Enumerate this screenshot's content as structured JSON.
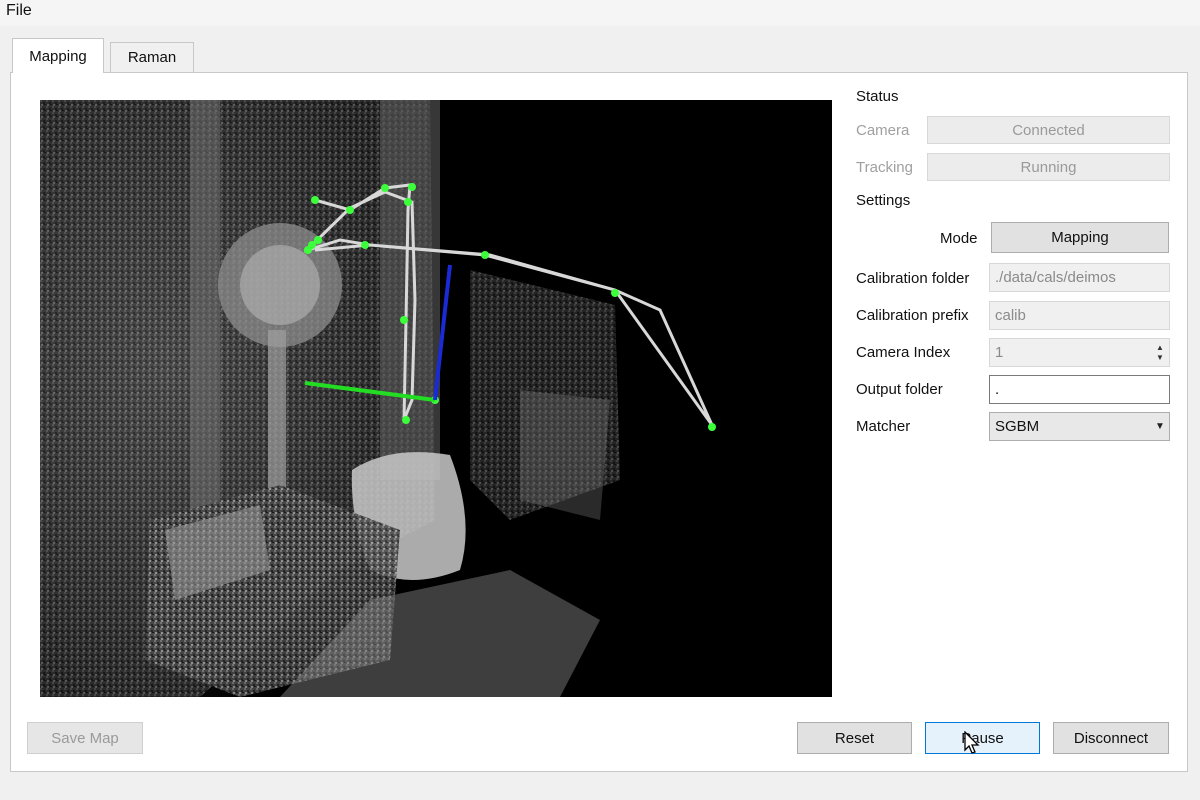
{
  "menu": {
    "file_label": "File"
  },
  "tabs": [
    {
      "label": "Mapping",
      "active": true
    },
    {
      "label": "Raman",
      "active": false
    }
  ],
  "status": {
    "title": "Status",
    "camera_label": "Camera",
    "camera_value": "Connected",
    "tracking_label": "Tracking",
    "tracking_value": "Running"
  },
  "settings": {
    "title": "Settings",
    "mode_label": "Mode",
    "mode_value": "Mapping",
    "calibration_folder_label": "Calibration folder",
    "calibration_folder_value": "./data/cals/deimos",
    "calibration_prefix_label": "Calibration prefix",
    "calibration_prefix_value": "calib",
    "camera_index_label": "Camera Index",
    "camera_index_value": "1",
    "output_folder_label": "Output folder",
    "output_folder_value": ".",
    "matcher_label": "Matcher",
    "matcher_value": "SGBM"
  },
  "buttons": {
    "save_map": "Save Map",
    "reset": "Reset",
    "pause": "Pause",
    "disconnect": "Disconnect"
  },
  "viewport": {
    "trajectory_color": "#d8d8d8",
    "keyframe_color": "#3cff3c",
    "axis_x_color": "#22dd22",
    "axis_z_color": "#1a2bd6"
  }
}
